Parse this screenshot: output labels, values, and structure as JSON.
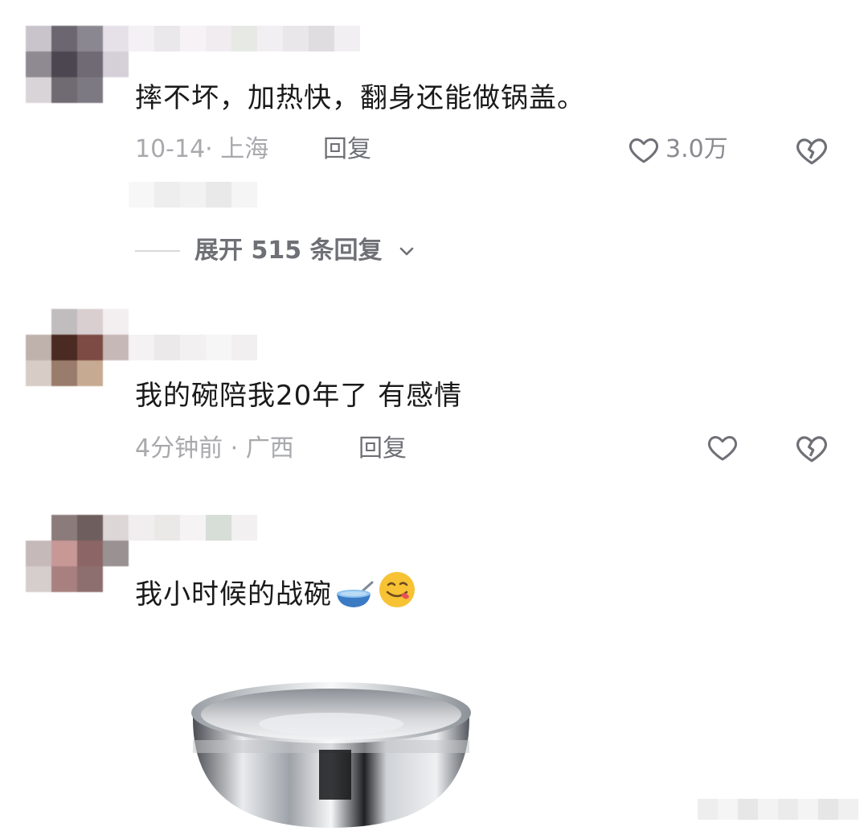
{
  "comments": [
    {
      "text": "摔不坏，加热快，翻身还能做锅盖。",
      "meta": "10-14· 上海",
      "reply_label": "回复",
      "like_count": "3.0万",
      "expand_label": "展开 515 条回复"
    },
    {
      "text": "我的碗陪我20年了 有感情",
      "meta": "4分钟前 · 广西",
      "reply_label": "回复"
    },
    {
      "text": "我小时候的战碗",
      "emojis": [
        "bowl-emoji",
        "wink-tongue-emoji"
      ]
    }
  ],
  "icons": {
    "like": "heart-outline-icon",
    "dislike": "broken-heart-icon",
    "expand": "chevron-down-icon"
  },
  "colors": {
    "text": "#1a1a1a",
    "meta": "#a8a9ad",
    "action": "#6f7076"
  }
}
